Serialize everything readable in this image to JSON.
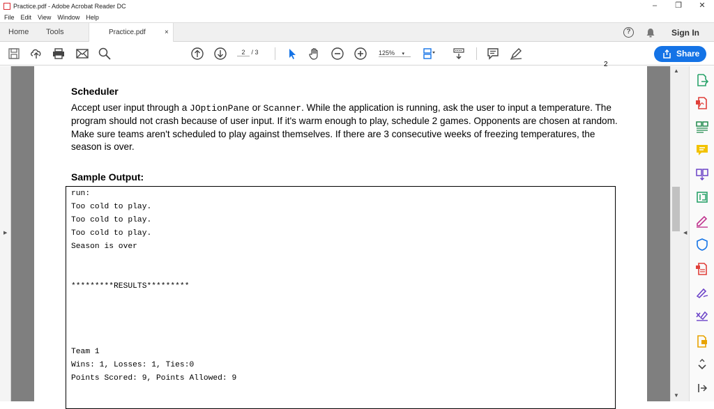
{
  "window": {
    "title": "Practice.pdf - Adobe Acrobat Reader DC",
    "controls": [
      "–",
      "❐",
      "✕"
    ]
  },
  "menu": [
    "File",
    "Edit",
    "View",
    "Window",
    "Help"
  ],
  "tabs": {
    "home": "Home",
    "tools": "Tools",
    "doc": "Practice.pdf",
    "close": "×"
  },
  "header": {
    "help": "?",
    "signin": "Sign In"
  },
  "toolbar": {
    "page_current": "2",
    "page_total": "/ 3",
    "zoom": "125%",
    "share_label": "Share"
  },
  "document": {
    "page_number": "2",
    "heading": "Scheduler",
    "para": {
      "p1": "Accept user input through a ",
      "code1": "JOptionPane",
      "p2": " or ",
      "code2": "Scanner",
      "p3": ". While the application is running, ask the user to input a temperature. The program should not crash because of user input. If it's warm enough to play, schedule 2 games. Opponents are chosen at random. Make sure teams aren't scheduled to play against themselves. If there are 3 consecutive weeks of freezing temperatures, the season is over."
    },
    "sample_heading": "Sample Output:",
    "output": [
      "run:",
      "Too cold to play.",
      "Too cold to play.",
      "Too cold to play.",
      "Season is over",
      "*********RESULTS*********",
      "Team 1",
      "Wins: 1, Losses: 1, Ties:0",
      "Points Scored: 9, Points Allowed: 9"
    ]
  },
  "icons": {
    "toolbar": [
      "save-icon",
      "upload-icon",
      "print-icon",
      "email-icon",
      "search-icon",
      "prev-page-icon",
      "next-page-icon",
      "select-icon",
      "hand-icon",
      "zoom-out-icon",
      "zoom-in-icon",
      "page-display-icon",
      "scroll-mode-icon",
      "comment-icon",
      "draw-icon"
    ],
    "right_panel": [
      "export-pdf-icon",
      "create-pdf-icon",
      "organize-pages-icon",
      "comment-tool-icon",
      "combine-files-icon",
      "edit-pdf-icon",
      "fill-sign-icon",
      "protect-icon",
      "print-production-icon",
      "sign-icon",
      "redact-icon",
      "more-tools-icon",
      "collapse-icon",
      "expand-panel-icon"
    ]
  },
  "colors": {
    "accent": "#1473e6",
    "brand_red": "#d9262d"
  }
}
